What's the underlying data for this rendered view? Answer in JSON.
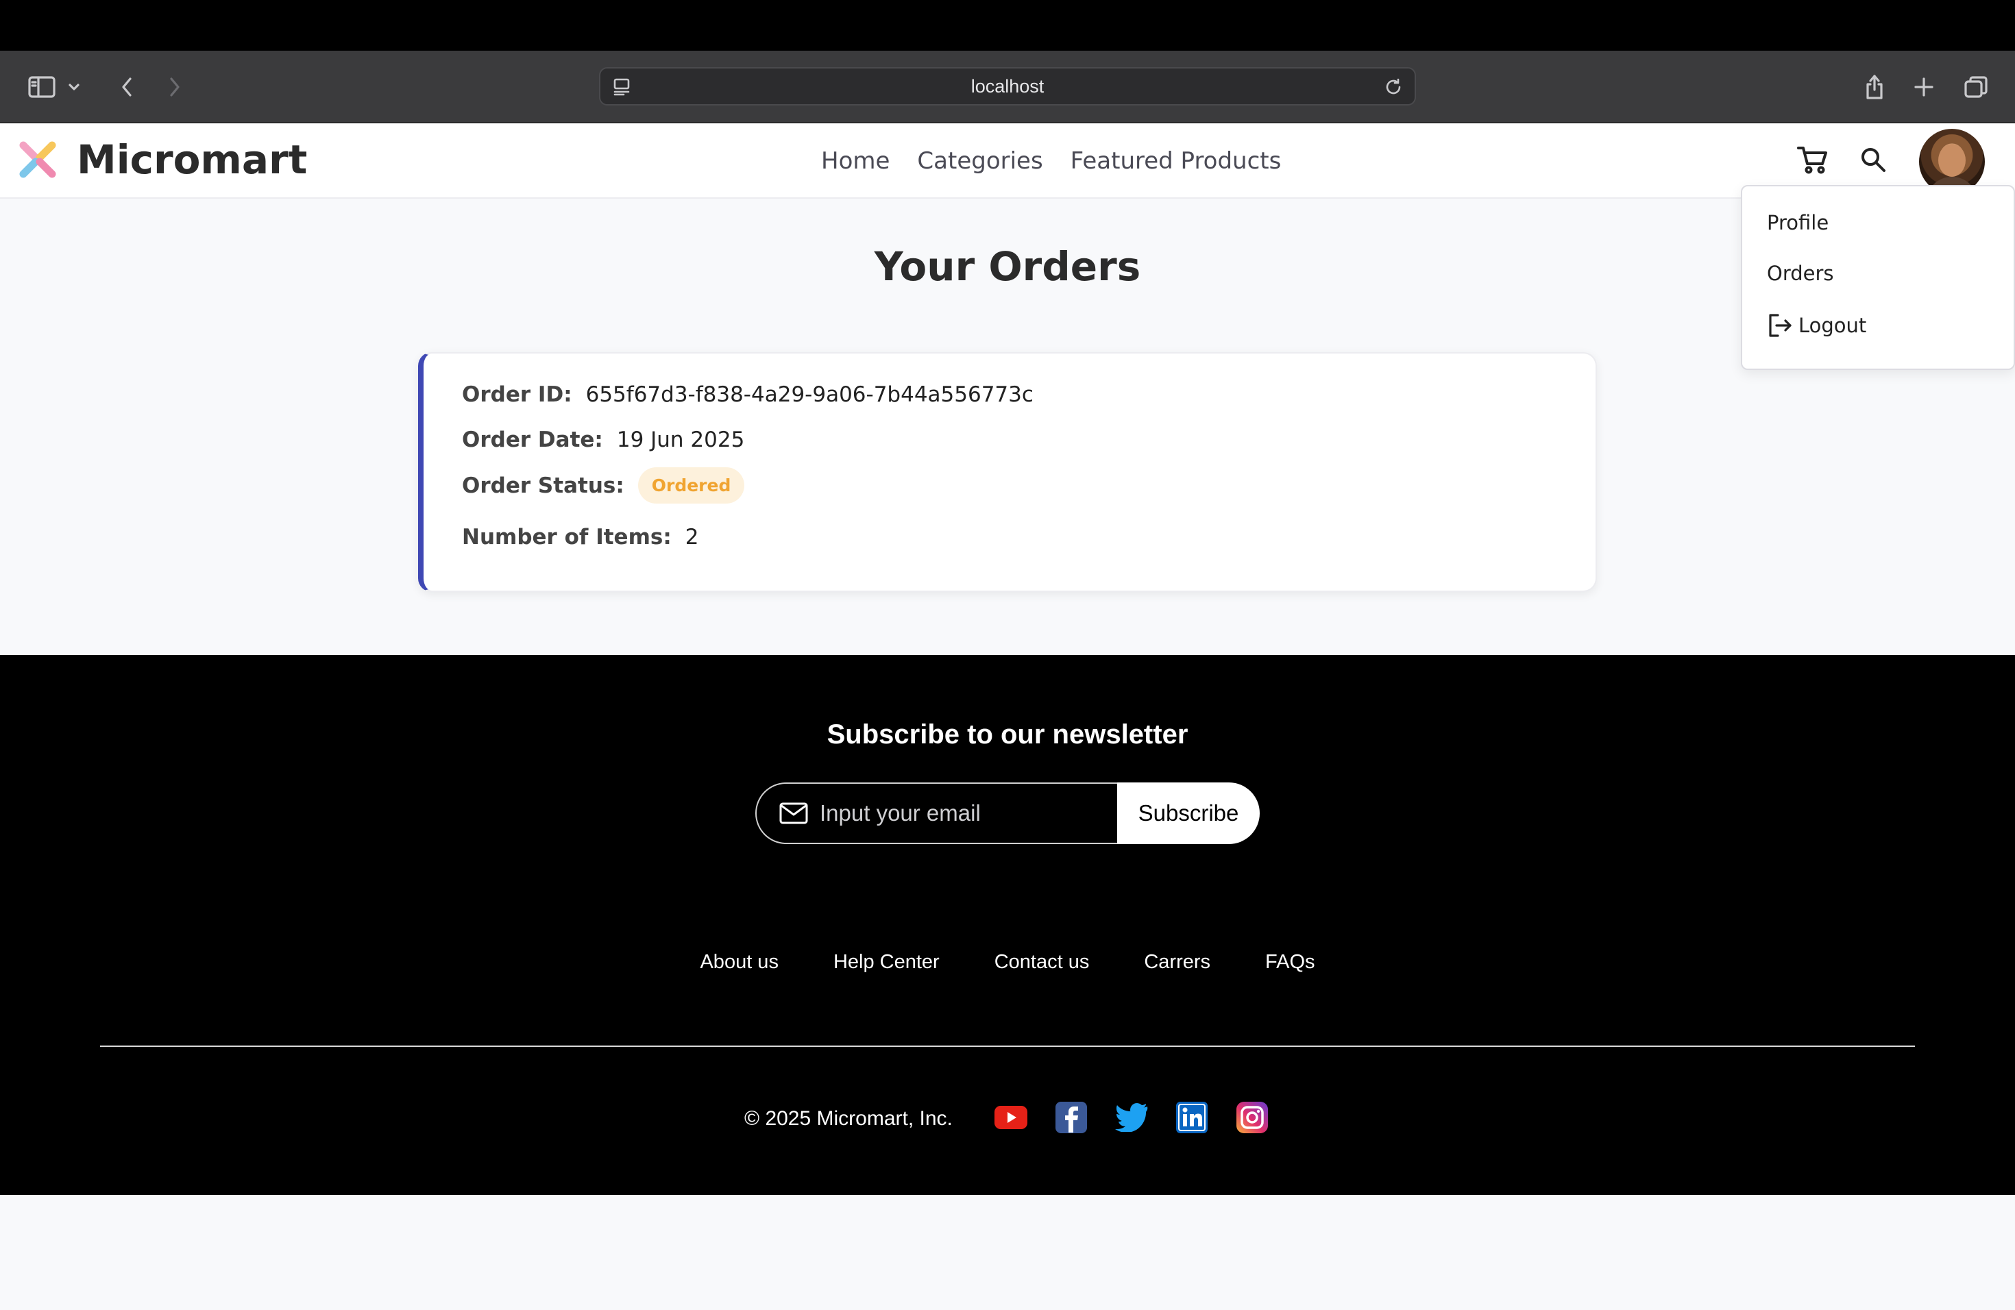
{
  "browser": {
    "url": "localhost",
    "icons": [
      "sidebar-icon",
      "chevron-down-icon",
      "back-arrow-icon",
      "forward-arrow-icon",
      "page-menu-icon",
      "reload-icon",
      "share-icon",
      "new-tab-icon",
      "tabs-overview-icon"
    ]
  },
  "header": {
    "brand": "Micromart",
    "nav": [
      "Home",
      "Categories",
      "Featured Products"
    ],
    "icons": [
      "cart-icon",
      "search-icon"
    ]
  },
  "user_menu": {
    "items": [
      "Profile",
      "Orders",
      "Logout"
    ]
  },
  "main": {
    "title": "Your Orders",
    "order": {
      "id_label": "Order ID:",
      "id": "655f67d3-f838-4a29-9a06-7b44a556773c",
      "date_label": "Order Date:",
      "date": "19 Jun 2025",
      "status_label": "Order Status:",
      "status": "Ordered",
      "items_label": "Number of Items:",
      "items": "2"
    }
  },
  "footer": {
    "newsletter_title": "Subscribe to our newsletter",
    "email_placeholder": "Input your email",
    "subscribe_label": "Subscribe",
    "links": [
      "About us",
      "Help Center",
      "Contact us",
      "Carrers",
      "FAQs"
    ],
    "copyright": "© 2025 Micromart, Inc.",
    "social": [
      "youtube-icon",
      "facebook-icon",
      "twitter-icon",
      "linkedin-icon",
      "instagram-icon"
    ]
  },
  "colors": {
    "accent_border": "#3f48b4",
    "status_text": "#f0a431",
    "status_bg": "#fdf1dc",
    "youtube": "#e62117",
    "facebook": "#3b5998",
    "twitter": "#1da1f2",
    "linkedin": "#0a66c2"
  }
}
